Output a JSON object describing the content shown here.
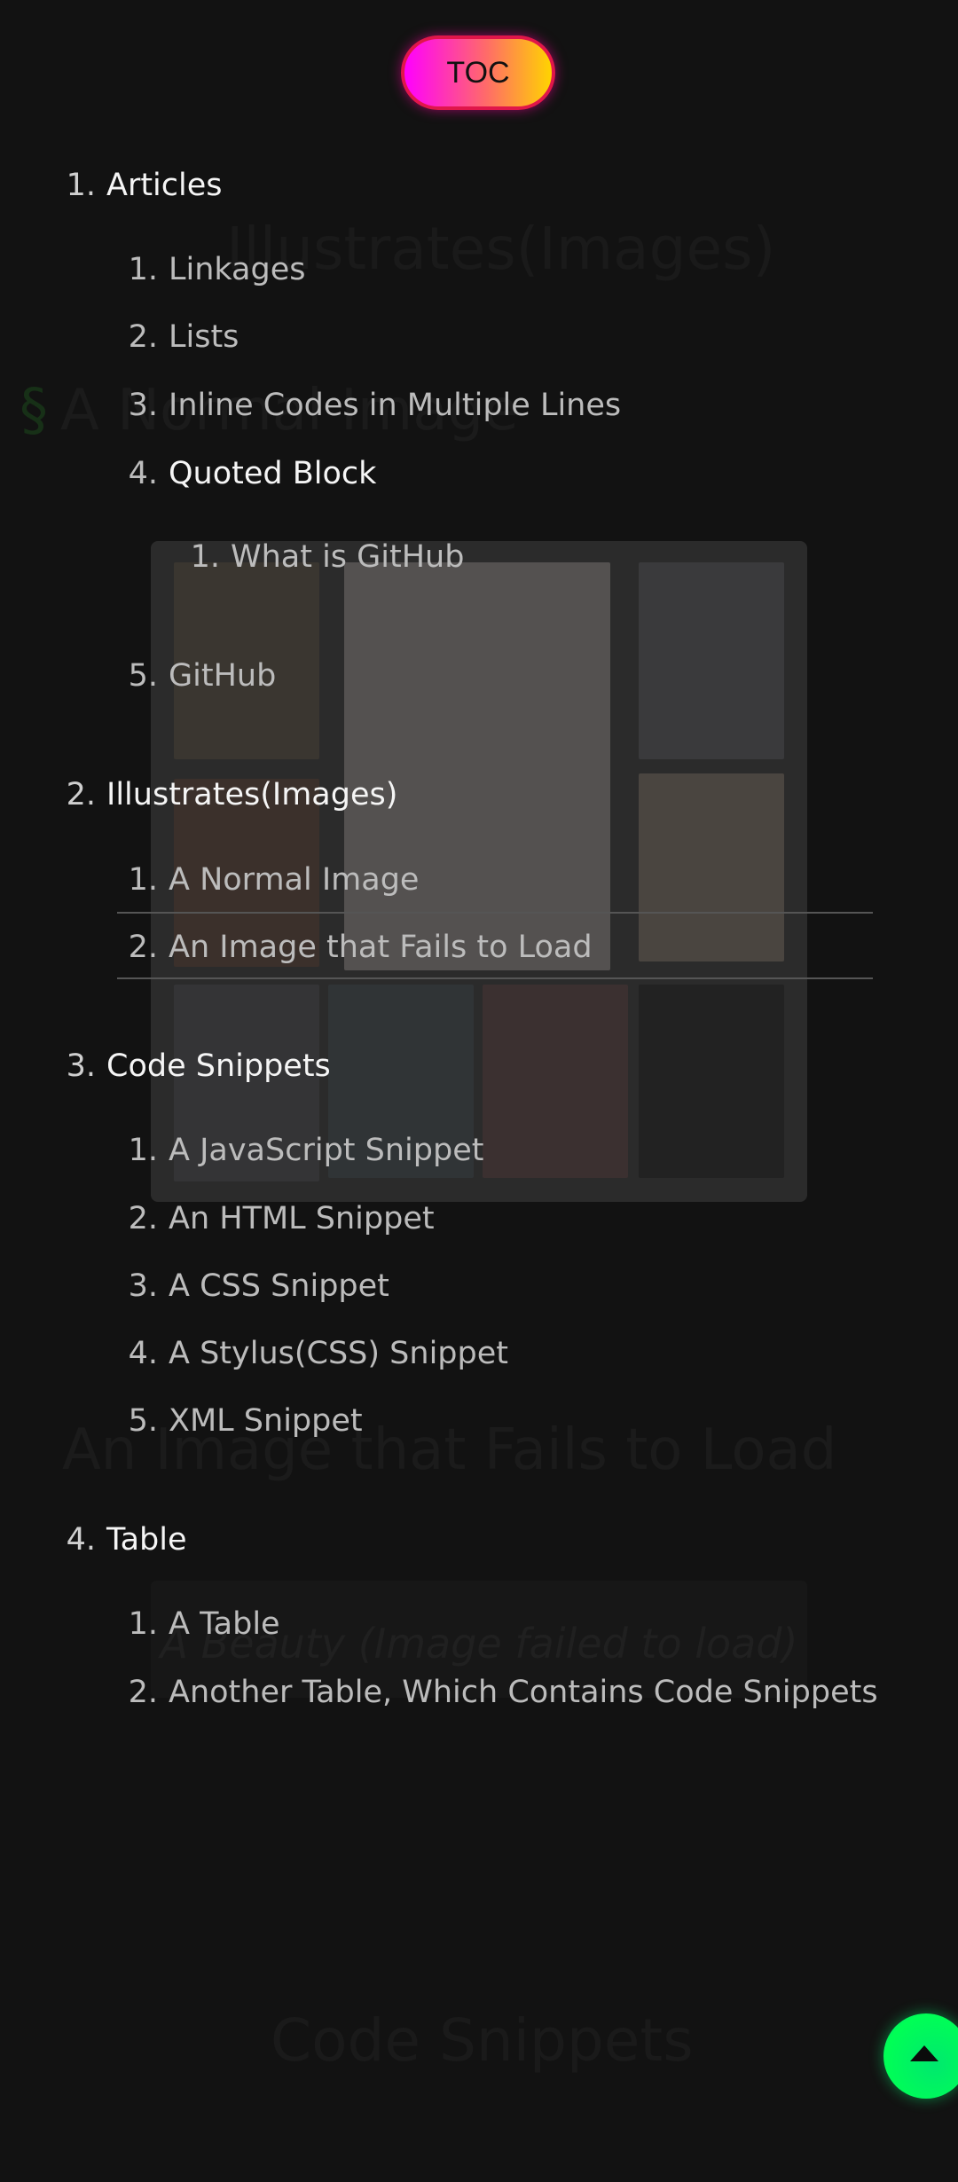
{
  "toc_button": {
    "label": "TOC"
  },
  "background": {
    "heading_illustrates": "Illustrates(Images)",
    "section_mark": "§",
    "heading_normal_image": "A Normal Image",
    "heading_failed_image": "An Image that Fails to Load",
    "failed_image_caption": "A Beauty (Image failed to load)",
    "heading_code_snippets": "Code Snippets"
  },
  "toc": [
    {
      "num": "1.",
      "label": "Articles",
      "children": [
        {
          "num": "1.",
          "label": "Linkages"
        },
        {
          "num": "2.",
          "label": "Lists"
        },
        {
          "num": "3.",
          "label": "Inline Codes in Multiple Lines"
        },
        {
          "num": "4.",
          "label": "Quoted Block",
          "children": [
            {
              "num": "1.",
              "label": "What is GitHub"
            }
          ]
        },
        {
          "num": "5.",
          "label": "GitHub"
        }
      ]
    },
    {
      "num": "2.",
      "label": "Illustrates(Images)",
      "children": [
        {
          "num": "1.",
          "label": "A Normal Image"
        },
        {
          "num": "2.",
          "label": "An Image that Fails to Load"
        }
      ]
    },
    {
      "num": "3.",
      "label": "Code Snippets",
      "children": [
        {
          "num": "1.",
          "label": "A JavaScript Snippet"
        },
        {
          "num": "2.",
          "label": "An HTML Snippet"
        },
        {
          "num": "3.",
          "label": "A CSS Snippet"
        },
        {
          "num": "4.",
          "label": "A Stylus(CSS) Snippet"
        },
        {
          "num": "5.",
          "label": "XML Snippet"
        }
      ]
    },
    {
      "num": "4.",
      "label": "Table",
      "children": [
        {
          "num": "1.",
          "label": "A Table"
        },
        {
          "num": "2.",
          "label": "Another Table, Which Contains Code Snippets"
        }
      ]
    }
  ],
  "back_to_top": {
    "icon": "arrow-up-icon"
  }
}
